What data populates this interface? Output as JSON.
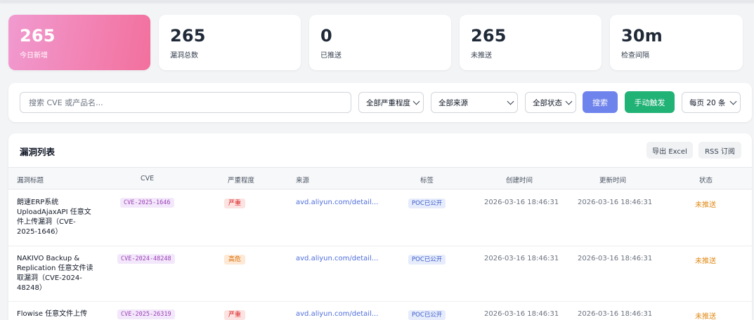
{
  "stats": [
    {
      "value": "265",
      "label": "今日新增"
    },
    {
      "value": "265",
      "label": "漏洞总数"
    },
    {
      "value": "0",
      "label": "已推送"
    },
    {
      "value": "265",
      "label": "未推送"
    },
    {
      "value": "30m",
      "label": "检查间隔"
    }
  ],
  "filters": {
    "search_placeholder": "搜索 CVE 或产品名...",
    "severity": "全部严重程度",
    "source": "全部来源",
    "status": "全部状态",
    "search_button": "搜索",
    "trigger_button": "手动触发",
    "page_size": "每页 20 条"
  },
  "panel": {
    "title": "漏洞列表",
    "export_label": "导出 Excel",
    "rss_label": "RSS 订阅"
  },
  "table": {
    "headers": [
      "漏洞标题",
      "CVE",
      "严重程度",
      "来源",
      "标签",
      "创建时间",
      "更新时间",
      "状态"
    ],
    "rows": [
      {
        "title": "朗速ERP系统 UploadAjaxAPI 任意文件上传漏洞（CVE-2025-1646）",
        "cve": "CVE-2025-1646",
        "severity": "严重",
        "severity_level": "critical",
        "source": "avd.aliyun.com/detail...",
        "tag": "POC已公开",
        "created": "2026-03-16 18:46:31",
        "updated": "2026-03-16 18:46:31",
        "status": "未推送"
      },
      {
        "title": "NAKIVO Backup & Replication 任意文件读取漏洞（CVE-2024-48248）",
        "cve": "CVE-2024-48248",
        "severity": "高危",
        "severity_level": "high",
        "source": "avd.aliyun.com/detail...",
        "tag": "POC已公开",
        "created": "2026-03-16 18:46:31",
        "updated": "2026-03-16 18:46:31",
        "status": "未推送"
      },
      {
        "title": "Flowise 任意文件上传",
        "cve": "CVE-2025-26319",
        "severity": "严重",
        "severity_level": "critical",
        "source": "avd.aliyun.com/detail...",
        "tag": "POC已公开",
        "created": "2026-03-16 18:46:31",
        "updated": "2026-03-16 18:46:31",
        "status": "未推送"
      }
    ]
  },
  "colors": {
    "accent": "#6f83ec",
    "trigger": "#21b276",
    "highlight_card_start": "#f19ad0",
    "highlight_card_end": "#f2709d",
    "pending_status": "#e08a16"
  }
}
